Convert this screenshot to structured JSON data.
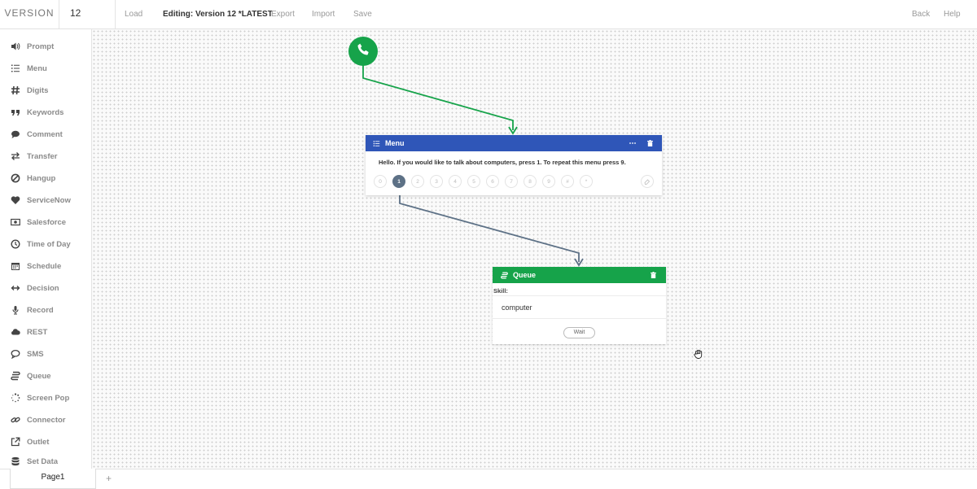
{
  "topbar": {
    "version_label": "VERSION",
    "version_number": "12",
    "load_label": "Load",
    "editing_label": "Editing: Version 12 *LATEST",
    "export_label": "Export",
    "import_label": "Import",
    "save_label": "Save",
    "back_label": "Back",
    "help_label": "Help"
  },
  "sidebar": {
    "items": [
      {
        "label": "Prompt",
        "icon": "speaker-icon"
      },
      {
        "label": "Menu",
        "icon": "list-icon"
      },
      {
        "label": "Digits",
        "icon": "hash-icon"
      },
      {
        "label": "Keywords",
        "icon": "quote-icon"
      },
      {
        "label": "Comment",
        "icon": "comment-icon"
      },
      {
        "label": "Transfer",
        "icon": "transfer-icon"
      },
      {
        "label": "Hangup",
        "icon": "ban-icon"
      },
      {
        "label": "ServiceNow",
        "icon": "heart-icon"
      },
      {
        "label": "Salesforce",
        "icon": "money-icon"
      },
      {
        "label": "Time of Day",
        "icon": "clock-icon"
      },
      {
        "label": "Schedule",
        "icon": "calendar-icon"
      },
      {
        "label": "Decision",
        "icon": "arrows-h-icon"
      },
      {
        "label": "Record",
        "icon": "microphone-icon"
      },
      {
        "label": "REST",
        "icon": "cloud-icon"
      },
      {
        "label": "SMS",
        "icon": "speech-bubble-icon"
      },
      {
        "label": "Queue",
        "icon": "queue-icon"
      },
      {
        "label": "Screen Pop",
        "icon": "spinner-icon"
      },
      {
        "label": "Connector",
        "icon": "link-icon"
      },
      {
        "label": "Outlet",
        "icon": "external-link-icon"
      },
      {
        "label": "Set Data",
        "icon": "database-icon"
      }
    ]
  },
  "menu_node": {
    "title": "Menu",
    "prompt_text": "Hello. If you would like to talk about computers, press 1. To repeat this menu press 9.",
    "keys": [
      "0",
      "1",
      "2",
      "3",
      "4",
      "5",
      "6",
      "7",
      "8",
      "9",
      "#",
      "*"
    ],
    "active_key": "1"
  },
  "queue_node": {
    "title": "Queue",
    "skill_label": "Skill:",
    "skill_value": "computer",
    "wait_label": "Wait"
  },
  "bottombar": {
    "page_tab_label": "Page1",
    "add_page_label": "+"
  },
  "colors": {
    "menu_header": "#2f56b8",
    "queue_header": "#16a34a",
    "start_node": "#16a34a",
    "active_key": "#5d7186",
    "wire_green": "#16a34a",
    "wire_slate": "#5d7186"
  }
}
